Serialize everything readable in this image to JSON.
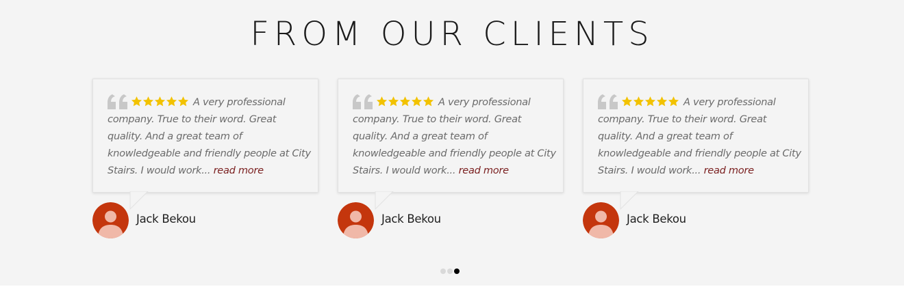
{
  "section": {
    "title": "FROM OUR CLIENTS"
  },
  "colors": {
    "background": "#f4f4f4",
    "star": "#f2c200",
    "quote_mark": "#c8c8c8",
    "avatar_bg": "#c4360d",
    "avatar_fg": "#f0b8a8",
    "read_more": "#7a1f1f"
  },
  "testimonials": [
    {
      "quote": "A very professional company. True to their word. Great quality. And a great team of knowledgeable and friendly people at City Stairs. I would work...",
      "read_more": "read more",
      "rating": 5,
      "author": "Jack Bekou",
      "icons": [
        "quote-mark-icon",
        "star-icon",
        "user-avatar-icon"
      ]
    },
    {
      "quote": "A very professional company. True to their word. Great quality. And a great team of knowledgeable and friendly people at City Stairs. I would work...",
      "read_more": "read more",
      "rating": 5,
      "author": "Jack Bekou",
      "icons": [
        "quote-mark-icon",
        "star-icon",
        "user-avatar-icon"
      ]
    },
    {
      "quote": "A very professional company. True to their word. Great quality. And a great team of knowledgeable and friendly people at City Stairs. I would work...",
      "read_more": "read more",
      "rating": 5,
      "author": "Jack Bekou",
      "icons": [
        "quote-mark-icon",
        "star-icon",
        "user-avatar-icon"
      ]
    }
  ],
  "carousel": {
    "pages": 3,
    "active_page": 3
  }
}
